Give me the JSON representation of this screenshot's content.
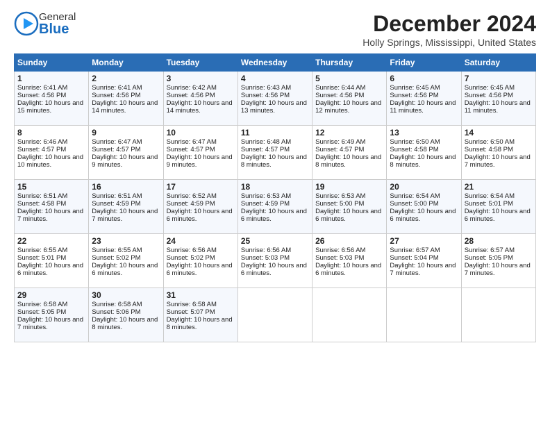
{
  "app": {
    "name_general": "General",
    "name_blue": "Blue"
  },
  "title": "December 2024",
  "location": "Holly Springs, Mississippi, United States",
  "days_of_week": [
    "Sunday",
    "Monday",
    "Tuesday",
    "Wednesday",
    "Thursday",
    "Friday",
    "Saturday"
  ],
  "weeks": [
    [
      {
        "day": 1,
        "sunrise": "6:41 AM",
        "sunset": "4:56 PM",
        "daylight": "10 hours and 15 minutes."
      },
      {
        "day": 2,
        "sunrise": "6:41 AM",
        "sunset": "4:56 PM",
        "daylight": "10 hours and 14 minutes."
      },
      {
        "day": 3,
        "sunrise": "6:42 AM",
        "sunset": "4:56 PM",
        "daylight": "10 hours and 14 minutes."
      },
      {
        "day": 4,
        "sunrise": "6:43 AM",
        "sunset": "4:56 PM",
        "daylight": "10 hours and 13 minutes."
      },
      {
        "day": 5,
        "sunrise": "6:44 AM",
        "sunset": "4:56 PM",
        "daylight": "10 hours and 12 minutes."
      },
      {
        "day": 6,
        "sunrise": "6:45 AM",
        "sunset": "4:56 PM",
        "daylight": "10 hours and 11 minutes."
      },
      {
        "day": 7,
        "sunrise": "6:45 AM",
        "sunset": "4:56 PM",
        "daylight": "10 hours and 11 minutes."
      }
    ],
    [
      {
        "day": 8,
        "sunrise": "6:46 AM",
        "sunset": "4:57 PM",
        "daylight": "10 hours and 10 minutes."
      },
      {
        "day": 9,
        "sunrise": "6:47 AM",
        "sunset": "4:57 PM",
        "daylight": "10 hours and 9 minutes."
      },
      {
        "day": 10,
        "sunrise": "6:47 AM",
        "sunset": "4:57 PM",
        "daylight": "10 hours and 9 minutes."
      },
      {
        "day": 11,
        "sunrise": "6:48 AM",
        "sunset": "4:57 PM",
        "daylight": "10 hours and 8 minutes."
      },
      {
        "day": 12,
        "sunrise": "6:49 AM",
        "sunset": "4:57 PM",
        "daylight": "10 hours and 8 minutes."
      },
      {
        "day": 13,
        "sunrise": "6:50 AM",
        "sunset": "4:58 PM",
        "daylight": "10 hours and 8 minutes."
      },
      {
        "day": 14,
        "sunrise": "6:50 AM",
        "sunset": "4:58 PM",
        "daylight": "10 hours and 7 minutes."
      }
    ],
    [
      {
        "day": 15,
        "sunrise": "6:51 AM",
        "sunset": "4:58 PM",
        "daylight": "10 hours and 7 minutes."
      },
      {
        "day": 16,
        "sunrise": "6:51 AM",
        "sunset": "4:59 PM",
        "daylight": "10 hours and 7 minutes."
      },
      {
        "day": 17,
        "sunrise": "6:52 AM",
        "sunset": "4:59 PM",
        "daylight": "10 hours and 6 minutes."
      },
      {
        "day": 18,
        "sunrise": "6:53 AM",
        "sunset": "4:59 PM",
        "daylight": "10 hours and 6 minutes."
      },
      {
        "day": 19,
        "sunrise": "6:53 AM",
        "sunset": "5:00 PM",
        "daylight": "10 hours and 6 minutes."
      },
      {
        "day": 20,
        "sunrise": "6:54 AM",
        "sunset": "5:00 PM",
        "daylight": "10 hours and 6 minutes."
      },
      {
        "day": 21,
        "sunrise": "6:54 AM",
        "sunset": "5:01 PM",
        "daylight": "10 hours and 6 minutes."
      }
    ],
    [
      {
        "day": 22,
        "sunrise": "6:55 AM",
        "sunset": "5:01 PM",
        "daylight": "10 hours and 6 minutes."
      },
      {
        "day": 23,
        "sunrise": "6:55 AM",
        "sunset": "5:02 PM",
        "daylight": "10 hours and 6 minutes."
      },
      {
        "day": 24,
        "sunrise": "6:56 AM",
        "sunset": "5:02 PM",
        "daylight": "10 hours and 6 minutes."
      },
      {
        "day": 25,
        "sunrise": "6:56 AM",
        "sunset": "5:03 PM",
        "daylight": "10 hours and 6 minutes."
      },
      {
        "day": 26,
        "sunrise": "6:56 AM",
        "sunset": "5:03 PM",
        "daylight": "10 hours and 6 minutes."
      },
      {
        "day": 27,
        "sunrise": "6:57 AM",
        "sunset": "5:04 PM",
        "daylight": "10 hours and 7 minutes."
      },
      {
        "day": 28,
        "sunrise": "6:57 AM",
        "sunset": "5:05 PM",
        "daylight": "10 hours and 7 minutes."
      }
    ],
    [
      {
        "day": 29,
        "sunrise": "6:58 AM",
        "sunset": "5:05 PM",
        "daylight": "10 hours and 7 minutes."
      },
      {
        "day": 30,
        "sunrise": "6:58 AM",
        "sunset": "5:06 PM",
        "daylight": "10 hours and 8 minutes."
      },
      {
        "day": 31,
        "sunrise": "6:58 AM",
        "sunset": "5:07 PM",
        "daylight": "10 hours and 8 minutes."
      },
      null,
      null,
      null,
      null
    ]
  ]
}
